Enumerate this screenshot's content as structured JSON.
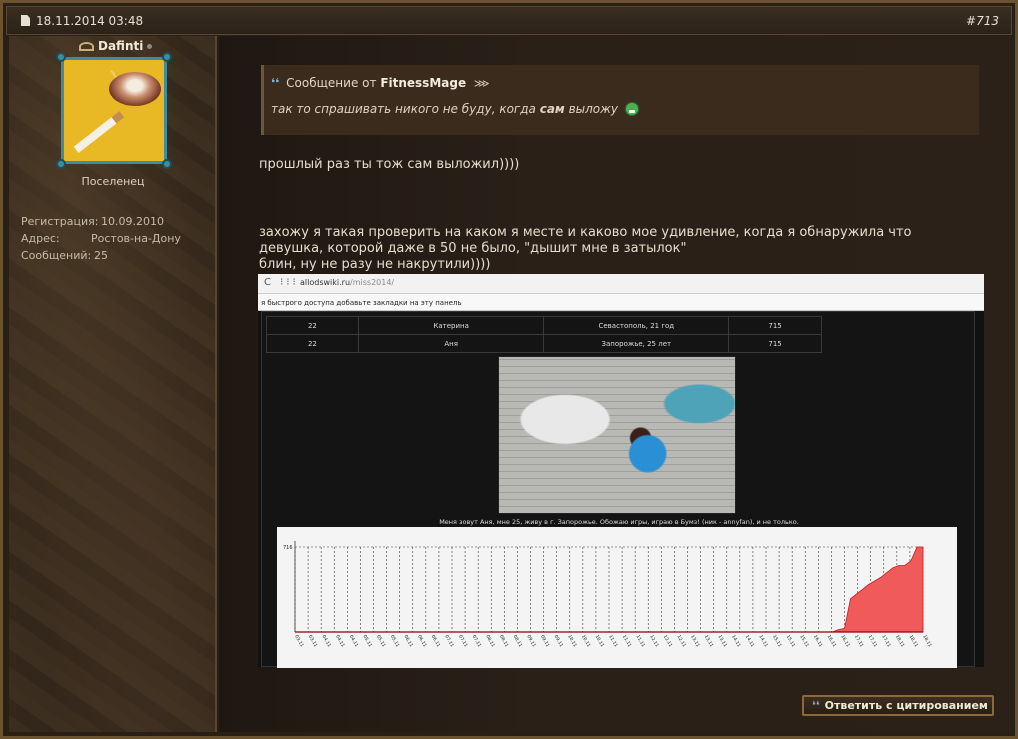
{
  "post": {
    "date": "18.11.2014 03:48",
    "number": "#713"
  },
  "user": {
    "name": "Dafinti",
    "rank": "Поселенец",
    "registration_label": "Регистрация:",
    "registration_value": "10.09.2010",
    "address_label": "Адрес:",
    "address_value": "Ростов-на-Дону",
    "posts_label": "Сообщений:",
    "posts_value": "25"
  },
  "quote": {
    "prefix": "Сообщение от",
    "author": "FitnessMage",
    "text_before": "так то спрашивать никого не буду, когда",
    "text_bold": "сам",
    "text_after": "выложу"
  },
  "message": {
    "line1": "прошлый раз ты тож сам выложил))))",
    "line2": "захожу я такая проверить на каком я месте и каково мое удивление, когда я обнаружила что девушка, которой даже в 50 не было, \"дышит мне в затылок\"",
    "line3": "блин, ну не разу не накрутили))))"
  },
  "screenshot": {
    "nav_icons": "C ⁝⁝⁝",
    "url_domain": "allodswiki.ru",
    "url_path": "/miss2014/",
    "bookmarks_hint": "я быстрого доступа добавьте закладки на эту панель",
    "rows": [
      {
        "place": "22",
        "name": "Катерина",
        "city": "Севастополь, 21 год",
        "votes": "715"
      },
      {
        "place": "22",
        "name": "Аня",
        "city": "Запорожье, 25 лет",
        "votes": "715"
      }
    ],
    "caption": "Меня зовут Аня, мне 25, живу в г. Запорожье. Обожаю игры, играю в Бумз! (ник - annyfan), и не только."
  },
  "reply_button": "Ответить с цитированием",
  "chart_data": {
    "type": "area",
    "ylabel_tick": "716",
    "ylim": [
      0,
      716
    ],
    "grid": true,
    "color": "#f15a5a",
    "x": [
      "03.11",
      "03.11",
      "04.11",
      "04.11",
      "04.11",
      "05.11",
      "05.11",
      "05.11",
      "06.11",
      "06.11",
      "06.11",
      "07.11",
      "07.11",
      "07.11",
      "08.11",
      "08.11",
      "08.11",
      "09.11",
      "09.11",
      "09.11",
      "10.11",
      "10.11",
      "10.11",
      "11.11",
      "11.11",
      "11.11",
      "12.11",
      "12.11",
      "12.11",
      "13.11",
      "13.11",
      "13.11",
      "14.11",
      "14.11",
      "14.11",
      "15.11",
      "15.11",
      "15.11",
      "16.11",
      "16.11",
      "16.11",
      "17.11",
      "17.11",
      "17.11",
      "18.11",
      "18.11",
      "18.11"
    ],
    "values": [
      0,
      0,
      0,
      0,
      0,
      0,
      0,
      0,
      0,
      0,
      0,
      0,
      0,
      0,
      0,
      0,
      0,
      0,
      0,
      0,
      0,
      0,
      0,
      0,
      0,
      0,
      0,
      0,
      0,
      0,
      0,
      0,
      0,
      0,
      0,
      0,
      0,
      0,
      0,
      0,
      0,
      0,
      0,
      0,
      0,
      0,
      0,
      0,
      0,
      0,
      0,
      0,
      0,
      0,
      0,
      0,
      0,
      0,
      0,
      0,
      0,
      0,
      0,
      0,
      0,
      0,
      0,
      0,
      0,
      0,
      0,
      0,
      0,
      0,
      0,
      0,
      0,
      0,
      0,
      0,
      0,
      0,
      0,
      0,
      0,
      0,
      0,
      0,
      0,
      0,
      20,
      30,
      280,
      320,
      360,
      400,
      430,
      460,
      500,
      540,
      560,
      560,
      600,
      716,
      716
    ]
  }
}
